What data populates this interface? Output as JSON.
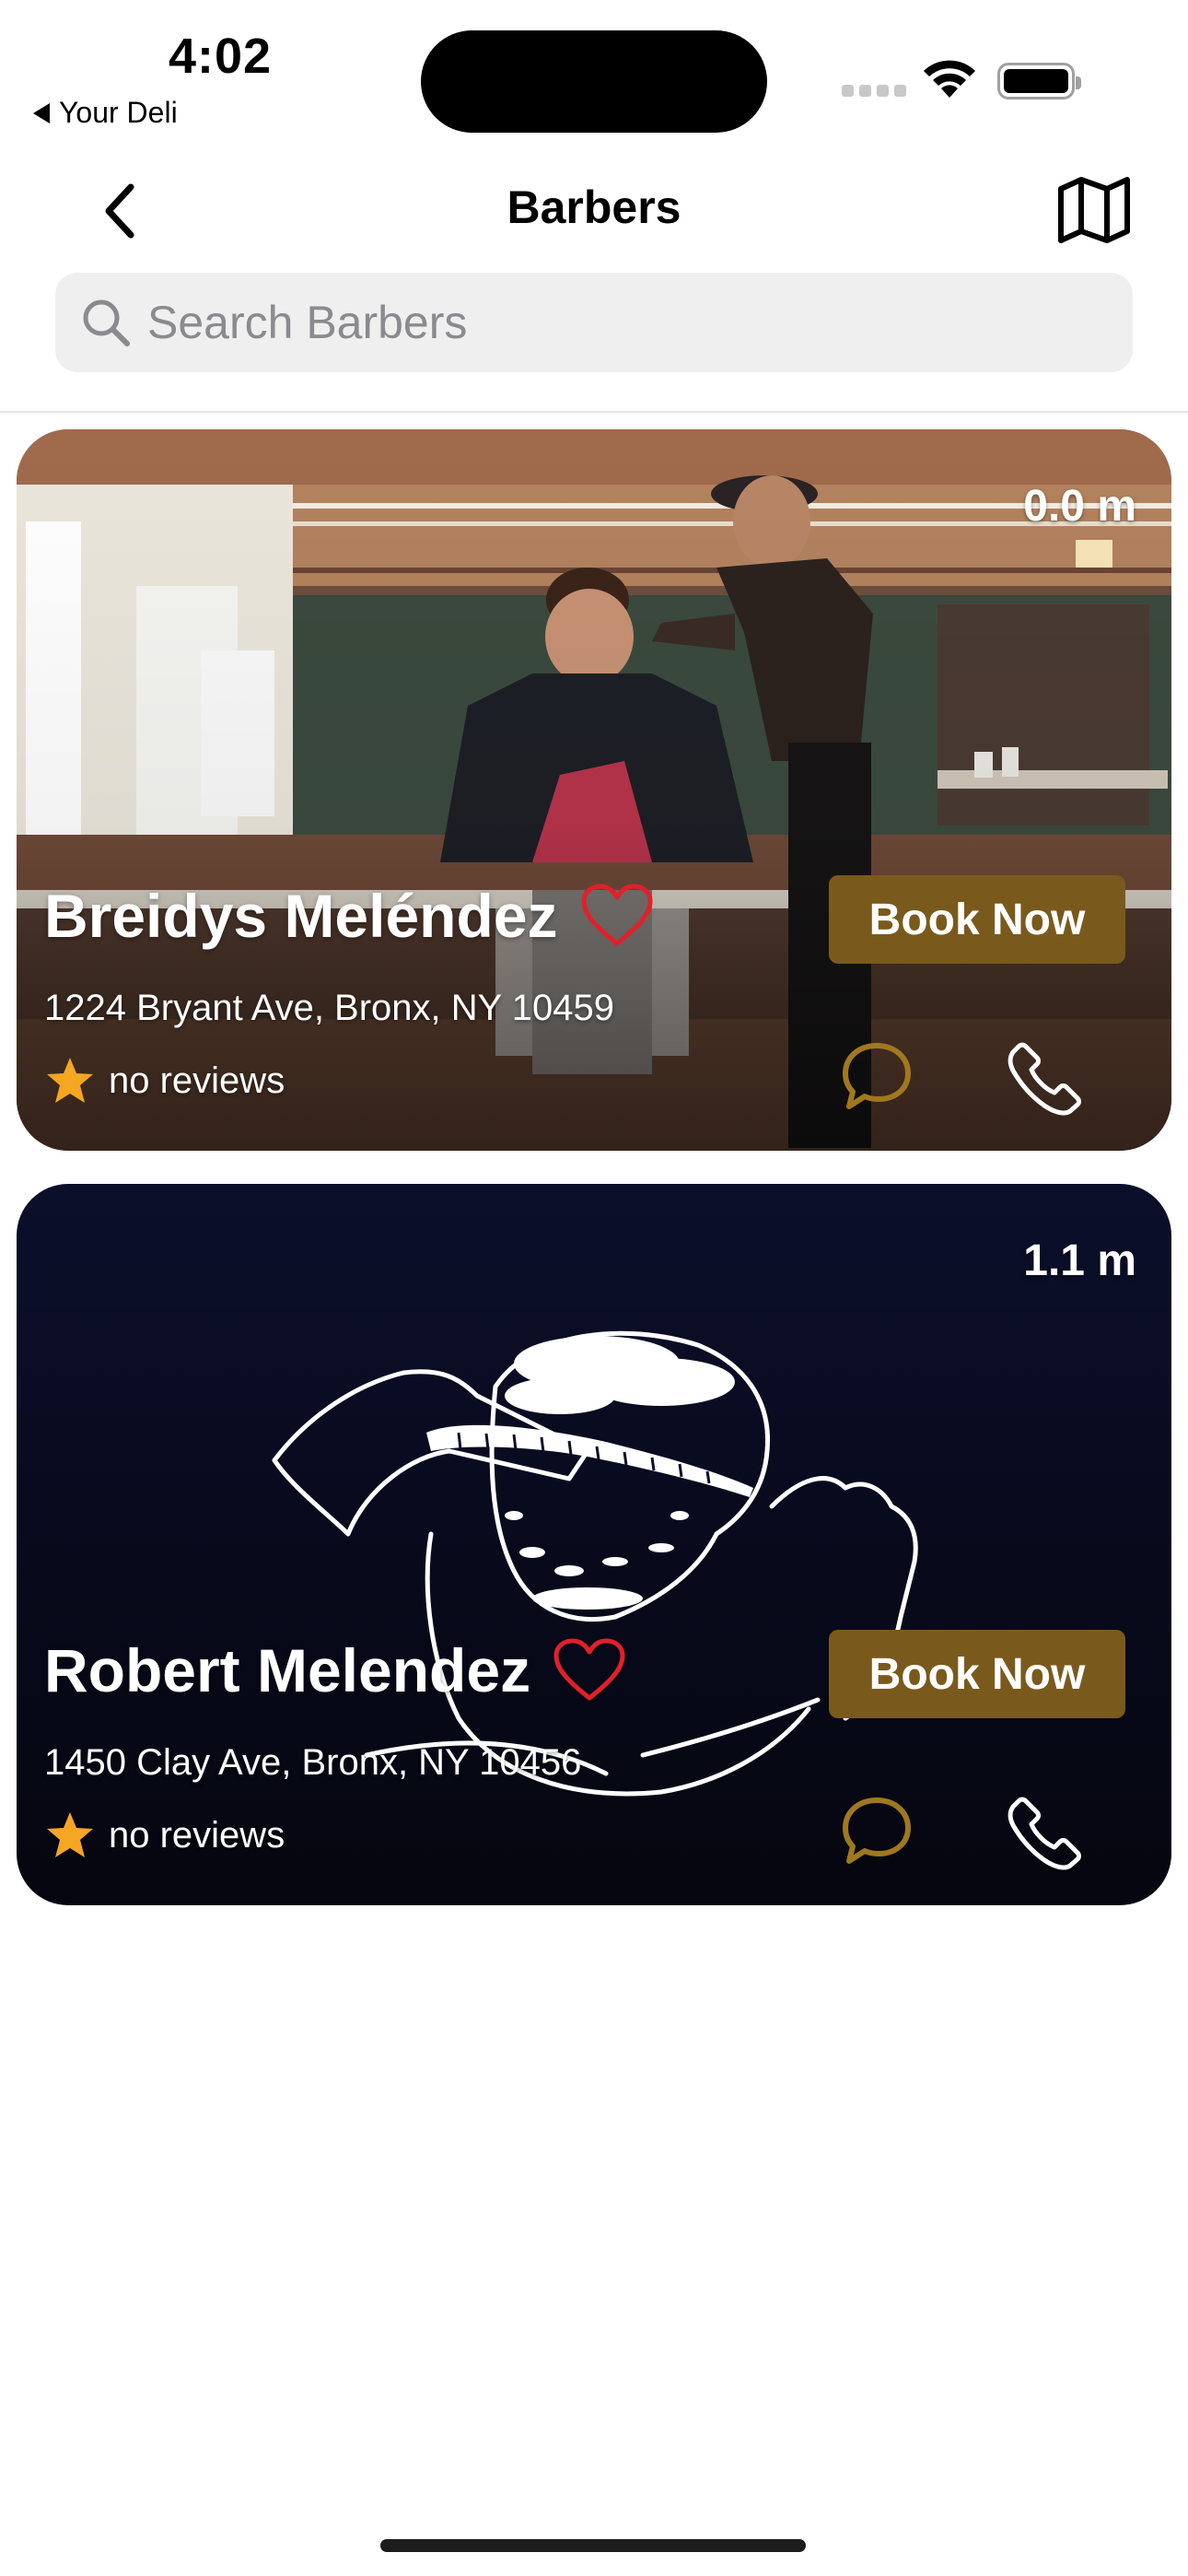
{
  "status_bar": {
    "time": "4:02",
    "back_app_label": "Your Deli"
  },
  "nav": {
    "title": "Barbers",
    "back_icon": "chevron-left-icon",
    "map_icon": "map-icon"
  },
  "search": {
    "placeholder": "Search Barbers",
    "value": ""
  },
  "barbers": [
    {
      "distance": "0.0 m",
      "name": "Breidys Meléndez",
      "address": "1224 Bryant Ave, Bronx, NY 10459",
      "rating_text": "no reviews",
      "book_label": "Book Now",
      "favorite": false
    },
    {
      "distance": "1.1 m",
      "name": "Robert Melendez",
      "address": "1450 Clay Ave, Bronx, NY 10456",
      "rating_text": "no reviews",
      "book_label": "Book Now",
      "favorite": false
    }
  ],
  "colors": {
    "accent": "#7a5a1c",
    "heart": "#e0202a",
    "star": "#f5a623",
    "card2_bg": "#0a0d24"
  }
}
